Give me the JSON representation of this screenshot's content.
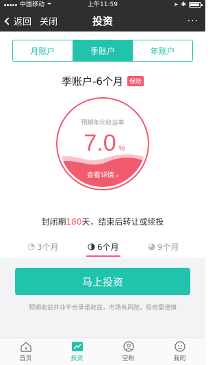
{
  "status": {
    "carrier": "中国移动",
    "time": "上午11:59"
  },
  "nav": {
    "back_label": "返回",
    "close_label": "关闭",
    "title": "投资",
    "more_label": "···"
  },
  "segment": {
    "items": [
      {
        "label": "月账户",
        "active": false
      },
      {
        "label": "季账户",
        "active": true
      },
      {
        "label": "年账户",
        "active": false
      }
    ]
  },
  "product": {
    "name": "季账户-6个月",
    "tag": "保险"
  },
  "yield": {
    "label": "预期年化收益率",
    "value": "7.0",
    "unit": "%",
    "detail_label": "查看详情 ›"
  },
  "period": {
    "prefix": "封闭期",
    "days": "180",
    "suffix": "天，结束后转让或续投"
  },
  "terms": {
    "tabs": [
      {
        "label": "3个月",
        "active": false
      },
      {
        "label": "6个月",
        "active": true
      },
      {
        "label": "9个月",
        "active": false
      }
    ]
  },
  "cta": {
    "label": "马上投资"
  },
  "disclaimer": "预期收益并非平台承诺收益，市场有风险，投资需谨慎",
  "tabbar": {
    "items": [
      {
        "label": "首页",
        "icon": "home-icon",
        "active": false
      },
      {
        "label": "投资",
        "icon": "chart-icon",
        "active": true
      },
      {
        "label": "空粉",
        "icon": "user-icon",
        "active": false
      },
      {
        "label": "我的",
        "icon": "profile-icon",
        "active": false
      }
    ]
  },
  "colors": {
    "accent": "#22c3ad",
    "highlight": "#f25a6e",
    "topbar": "#2f2f2f"
  }
}
